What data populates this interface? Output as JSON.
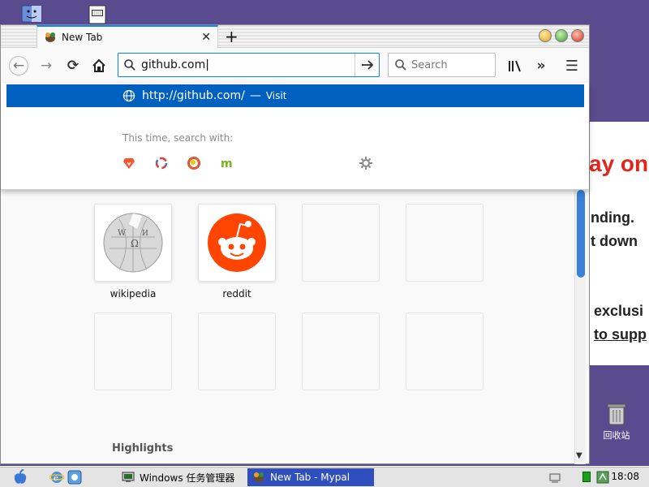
{
  "browser": {
    "tab": {
      "title": "New Tab"
    },
    "url_value": "github.com",
    "search_placeholder": "Search",
    "colors": {
      "accent": "#0a84ff",
      "selection": "#0060c0"
    }
  },
  "dropdown": {
    "suggestion_url": "http://github.com/",
    "suggestion_sep": "—",
    "suggestion_action": "Visit",
    "search_with_label": "This time, search with:",
    "engines": [
      "brave-icon",
      "qwant-icon",
      "duckduckgo-icon",
      "mojeek-icon"
    ]
  },
  "top_sites": [
    {
      "label": "wikipedia",
      "icon": "wikipedia-logo"
    },
    {
      "label": "reddit",
      "icon": "reddit-logo"
    }
  ],
  "highlights_label": "Highlights",
  "background_page": {
    "lines": [
      "ay on",
      "nding.",
      "t down",
      "exclusi",
      "to supp"
    ]
  },
  "desktop": {
    "recycle_bin_label": "回收站"
  },
  "taskbar": {
    "tasks": [
      "Windows 任务管理器",
      "New Tab - Mypal"
    ],
    "clock": "18:08"
  }
}
